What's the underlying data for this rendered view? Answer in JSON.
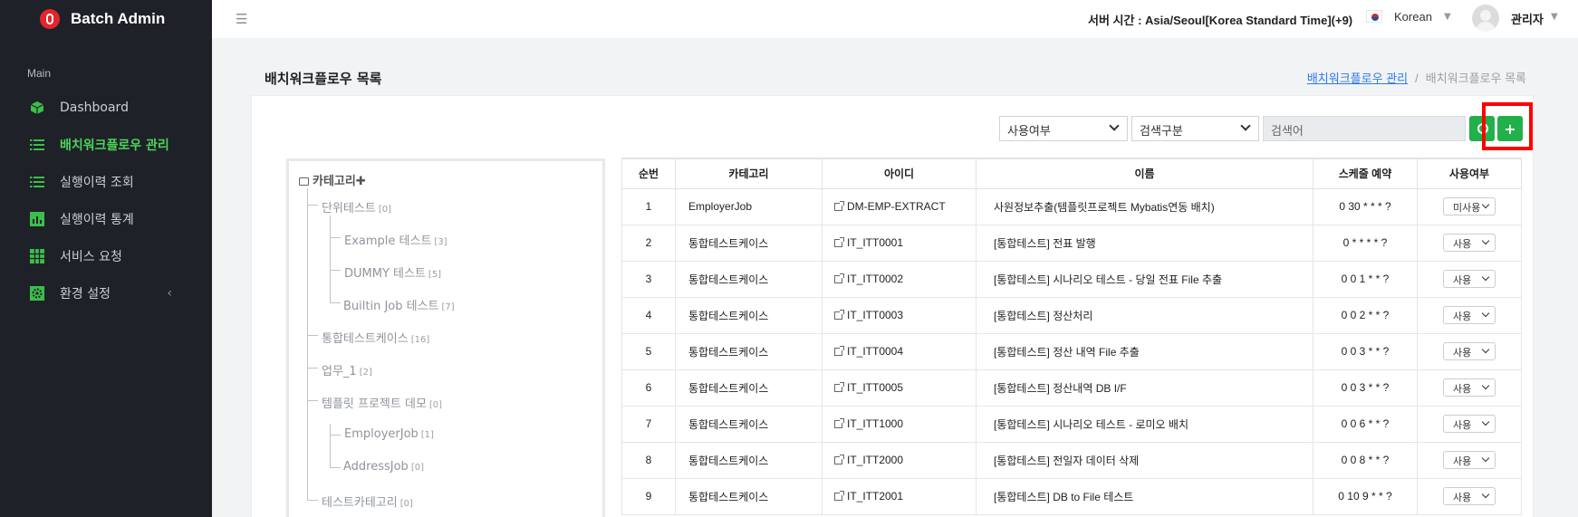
{
  "brand": {
    "title": "Batch Admin"
  },
  "sidebar": {
    "section": "Main",
    "items": [
      {
        "label": "Dashboard",
        "icon": "cube-icon",
        "active": false
      },
      {
        "label": "배치워크플로우 관리",
        "icon": "list-icon",
        "active": true
      },
      {
        "label": "실행이력 조회",
        "icon": "list-icon",
        "active": false
      },
      {
        "label": "실행이력 통계",
        "icon": "bar-chart-icon",
        "active": false
      },
      {
        "label": "서비스 요청",
        "icon": "grid-icon",
        "active": false
      },
      {
        "label": "환경 설정",
        "icon": "gear-icon",
        "active": false
      }
    ],
    "accent": "#4cd45a"
  },
  "header": {
    "server_time": "서버 시간 : Asia/Seoul[Korea Standard Time](+9)",
    "language": "Korean",
    "user": "관리자"
  },
  "page": {
    "title": "배치워크플로우 목록",
    "breadcrumb": {
      "parent": "배치워크플로우 관리",
      "current": "배치워크플로우 목록"
    }
  },
  "filters": {
    "use_select": "사용여부",
    "search_type": "검색구분",
    "search_placeholder": "검색어",
    "add_label": "+"
  },
  "tree": {
    "root": "카테고리",
    "nodes": [
      {
        "label": "단위테스트",
        "count": "[0]"
      },
      {
        "label": "Example 테스트",
        "count": "[3]"
      },
      {
        "label": "DUMMY 테스트",
        "count": "[5]"
      },
      {
        "label": "Builtin Job 테스트",
        "count": "[7]"
      },
      {
        "label": "통합테스트케이스",
        "count": "[16]"
      },
      {
        "label": "업무_1",
        "count": "[2]"
      },
      {
        "label": "템플릿 프로젝트 데모",
        "count": "[0]"
      },
      {
        "label": "EmployerJob",
        "count": "[1]"
      },
      {
        "label": "AddressJob",
        "count": "[0]"
      },
      {
        "label": "테스트카테고리",
        "count": "[0]"
      }
    ]
  },
  "table": {
    "headers": [
      "순번",
      "카테고리",
      "아이디",
      "이름",
      "스케줄 예약",
      "사용여부"
    ],
    "rows": [
      {
        "no": "1",
        "category": "EmployerJob",
        "id": "DM-EMP-EXTRACT",
        "name": "사원정보추출(템플릿프로젝트 Mybatis연동 배치)",
        "schedule": "0 30 * * * ?",
        "use": "미사용"
      },
      {
        "no": "2",
        "category": "통합테스트케이스",
        "id": "IT_ITT0001",
        "name": "[통합테스트] 전표 발행",
        "schedule": "0 * * * * ?",
        "use": "사용"
      },
      {
        "no": "3",
        "category": "통합테스트케이스",
        "id": "IT_ITT0002",
        "name": "[통합테스트] 시나리오 테스트 - 당일 전표 File 추출",
        "schedule": "0 0 1 * * ?",
        "use": "사용"
      },
      {
        "no": "4",
        "category": "통합테스트케이스",
        "id": "IT_ITT0003",
        "name": "[통합테스트] 정산처리",
        "schedule": "0 0 2 * * ?",
        "use": "사용"
      },
      {
        "no": "5",
        "category": "통합테스트케이스",
        "id": "IT_ITT0004",
        "name": "[통합테스트] 정산 내역 File 추출",
        "schedule": "0 0 3 * * ?",
        "use": "사용"
      },
      {
        "no": "6",
        "category": "통합테스트케이스",
        "id": "IT_ITT0005",
        "name": "[통합테스트] 정산내역 DB I/F",
        "schedule": "0 0 3 * * ?",
        "use": "사용"
      },
      {
        "no": "7",
        "category": "통합테스트케이스",
        "id": "IT_ITT1000",
        "name": "[통합테스트] 시나리오 테스트 - 로미오 배치",
        "schedule": "0 0 6 * * ?",
        "use": "사용"
      },
      {
        "no": "8",
        "category": "통합테스트케이스",
        "id": "IT_ITT2000",
        "name": "[통합테스트] 전일자 데이터 삭제",
        "schedule": "0 0 8 * * ?",
        "use": "사용"
      },
      {
        "no": "9",
        "category": "통합테스트케이스",
        "id": "IT_ITT2001",
        "name": "[통합테스트] DB to File 테스트",
        "schedule": "0 10 9 * * ?",
        "use": "사용"
      }
    ]
  }
}
